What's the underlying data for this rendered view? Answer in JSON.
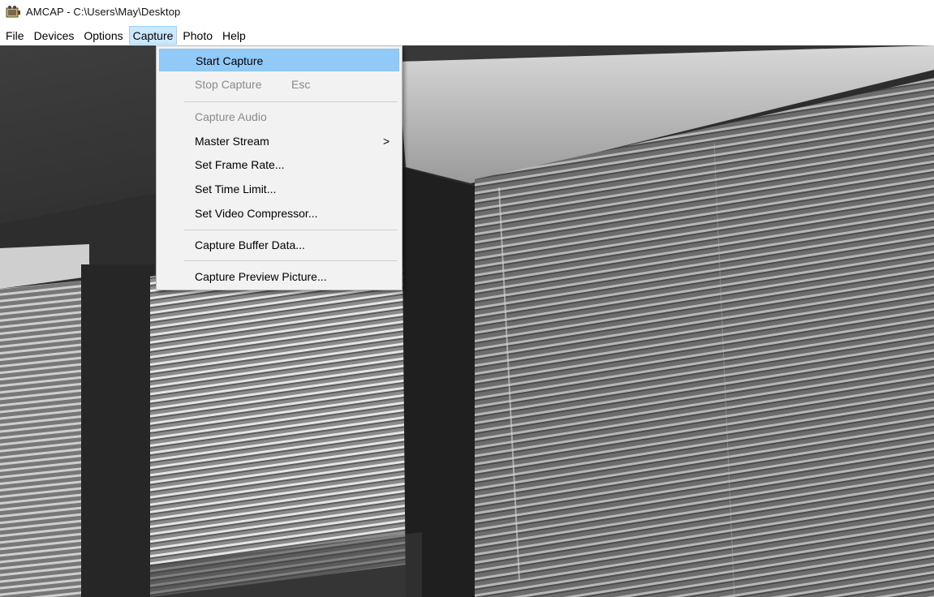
{
  "window": {
    "title": "AMCAP - C:\\Users\\May\\Desktop",
    "icon": "amcap-camera-icon"
  },
  "menubar": {
    "items": [
      {
        "label": "File"
      },
      {
        "label": "Devices"
      },
      {
        "label": "Options"
      },
      {
        "label": "Capture",
        "active": true
      },
      {
        "label": "Photo"
      },
      {
        "label": "Help"
      }
    ]
  },
  "capture_menu": {
    "items": [
      {
        "label": "Start Capture",
        "highlighted": true
      },
      {
        "label": "Stop Capture",
        "shortcut": "Esc",
        "disabled": true
      },
      {
        "label": "Capture Audio",
        "disabled": true
      },
      {
        "label": "Master Stream",
        "submenu_arrow": ">"
      },
      {
        "label": "Set Frame Rate..."
      },
      {
        "label": "Set Time Limit..."
      },
      {
        "label": "Set Video Compressor..."
      },
      {
        "label": "Capture Buffer Data..."
      },
      {
        "label": "Capture Preview Picture..."
      }
    ]
  },
  "colors": {
    "menu_highlight": "#91c9f7",
    "menubar_active": "#cce8ff",
    "disabled_text": "#8a8a8a"
  }
}
